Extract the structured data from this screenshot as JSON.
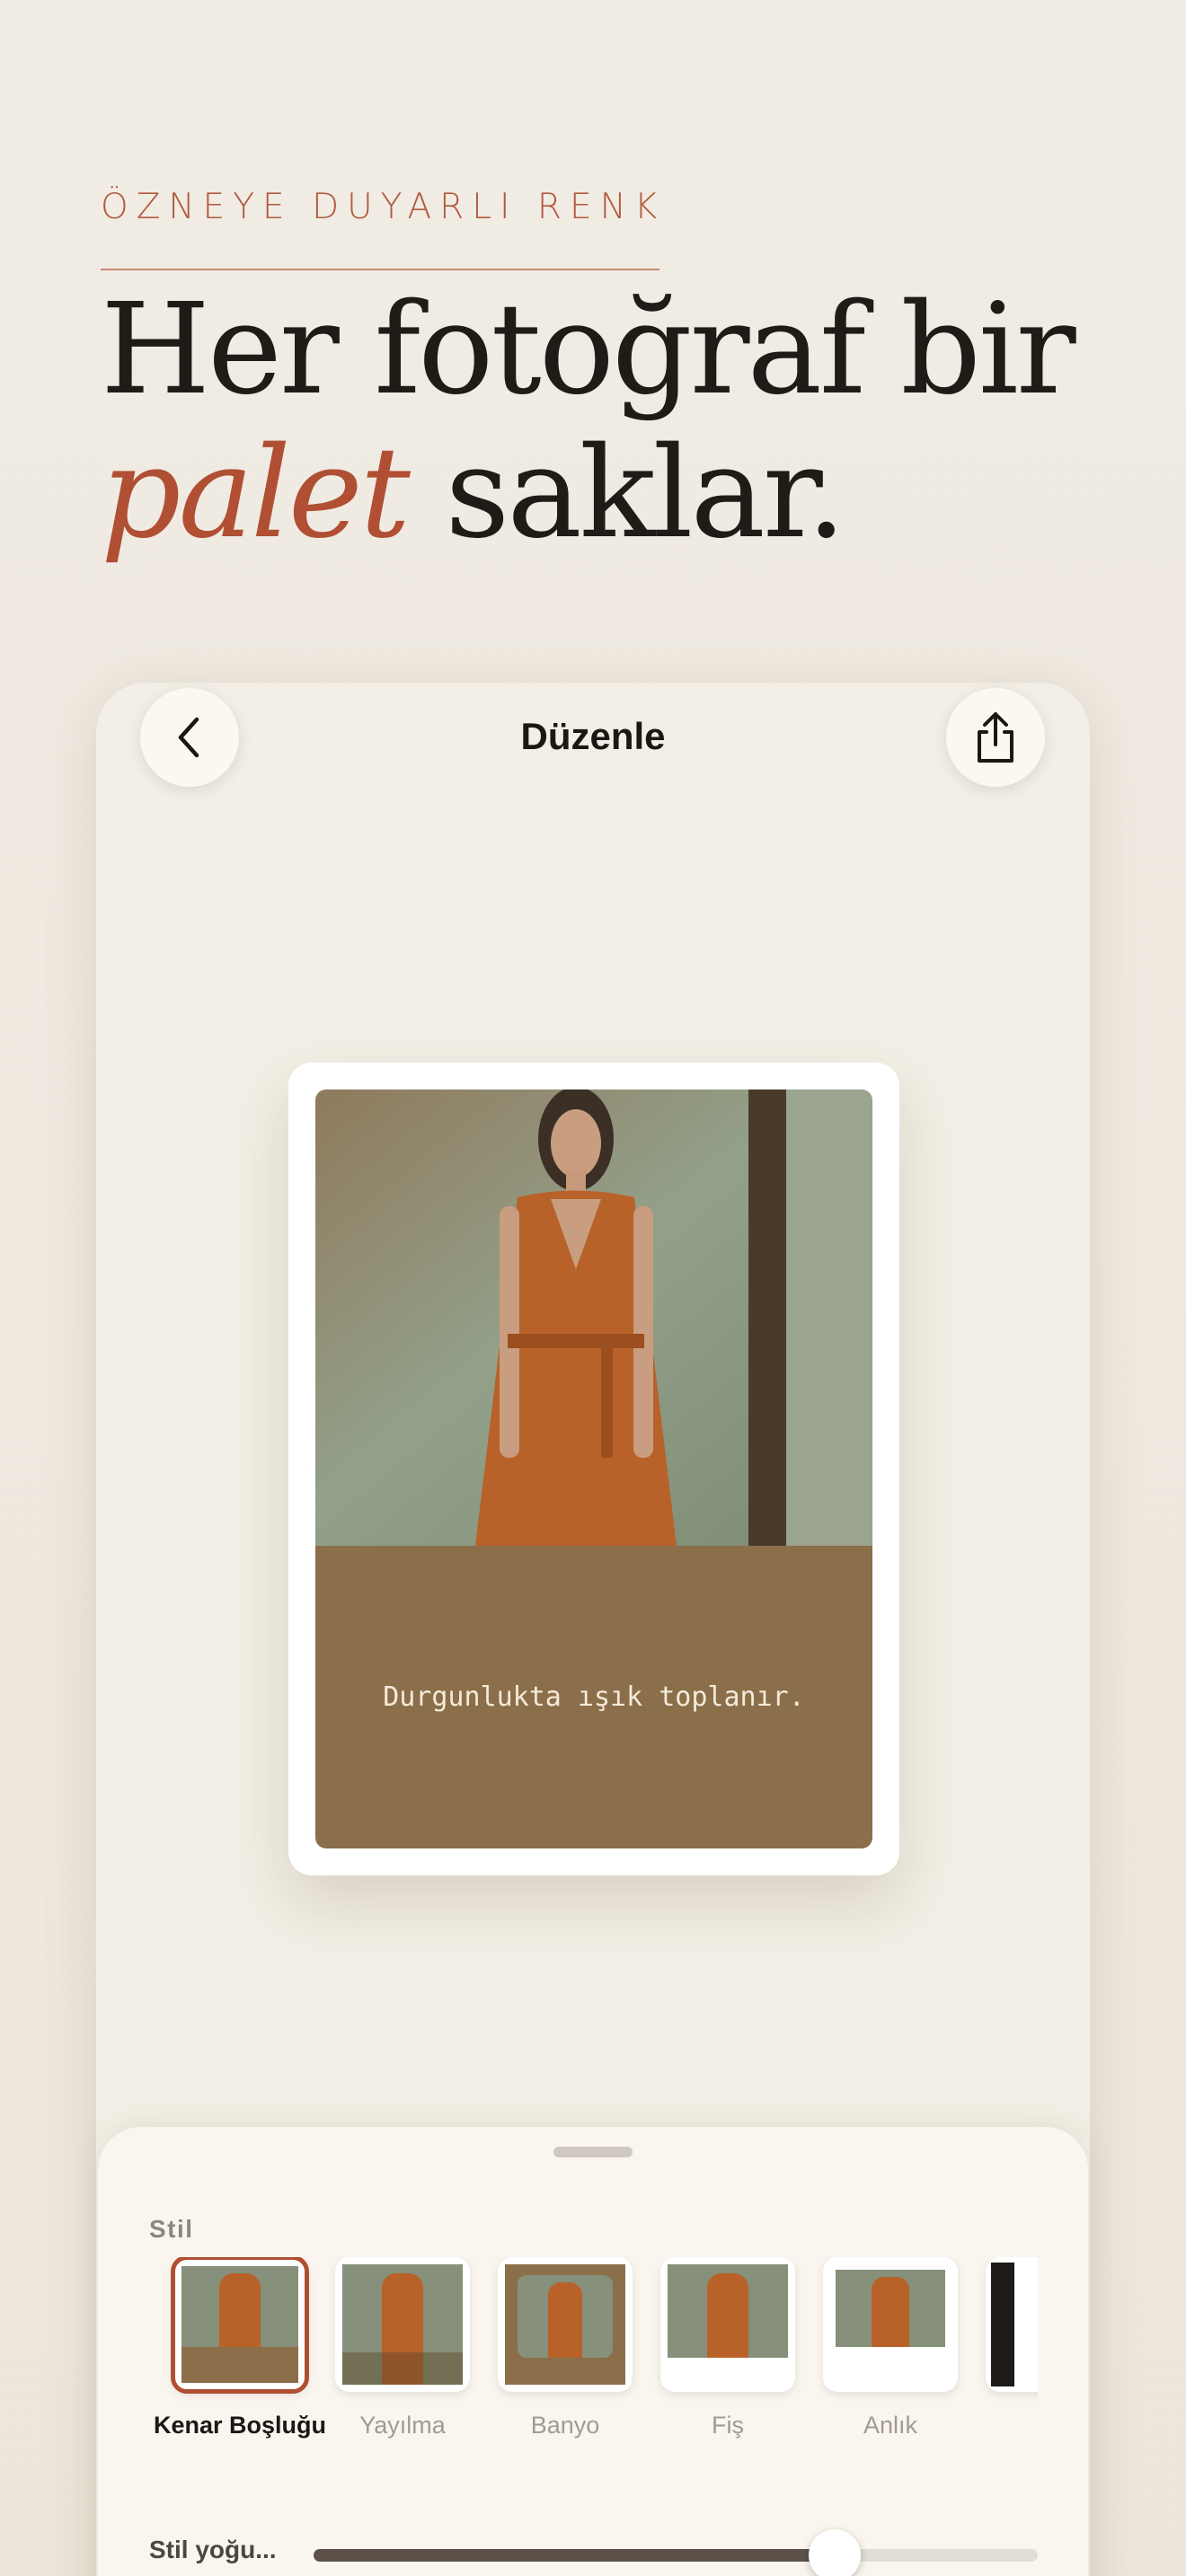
{
  "hero": {
    "eyebrow": "ÖZNEYE DUYARLI RENK",
    "headline_line1": "Her fotoğraf bir",
    "headline_accent": "palet",
    "headline_rest": " saklar."
  },
  "editor": {
    "title": "Düzenle",
    "back_icon": "chevron-left-icon",
    "share_icon": "share-icon"
  },
  "card": {
    "caption": "Durgunlukta ışık toplanır.",
    "caption_color": "#8b6e4a"
  },
  "sheet": {
    "style_label": "Stil",
    "styles": [
      {
        "name": "Kenar Boşluğu",
        "selected": true
      },
      {
        "name": "Yayılma",
        "selected": false
      },
      {
        "name": "Banyo",
        "selected": false
      },
      {
        "name": "Fiş",
        "selected": false
      },
      {
        "name": "Anlık",
        "selected": false
      }
    ],
    "slider_label": "Stil yoğu...",
    "slider_value": 0.72
  },
  "colors": {
    "accent": "#b04f33",
    "background": "#f1ece4",
    "dress": "#b8622a"
  }
}
